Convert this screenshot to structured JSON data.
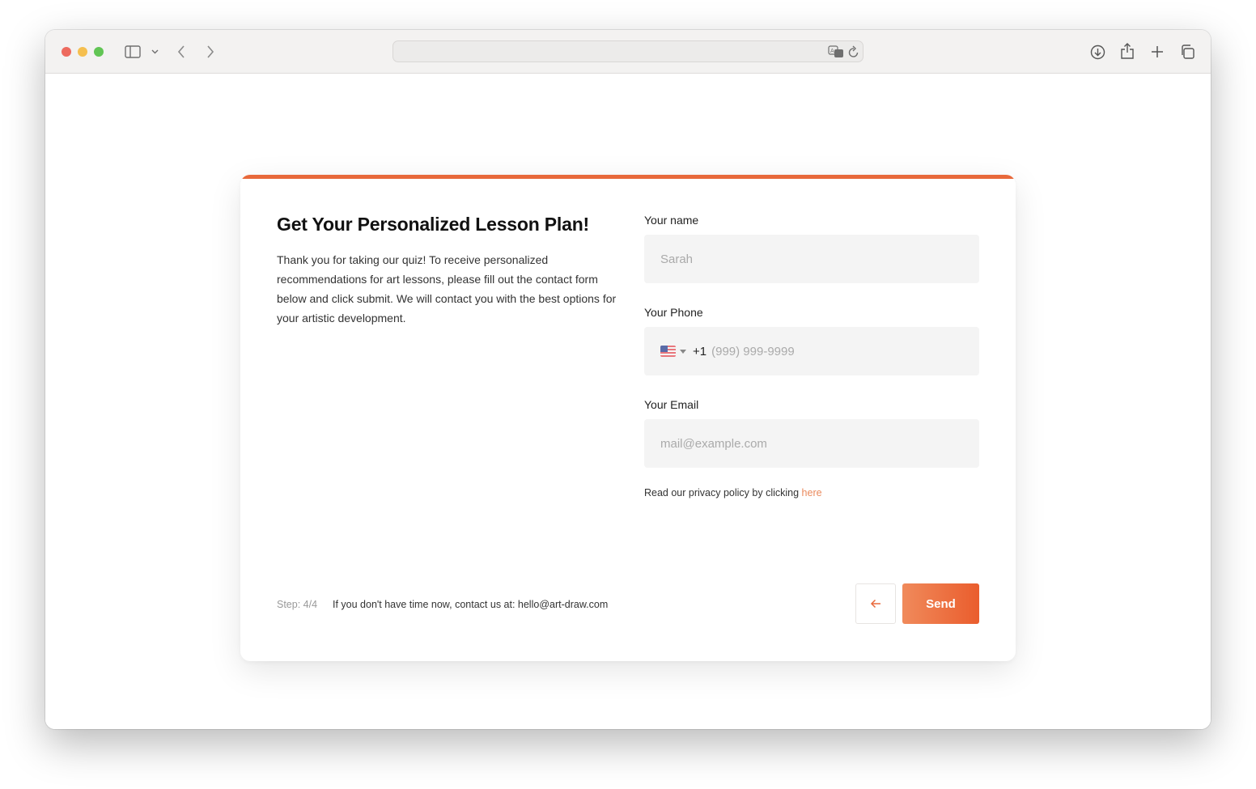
{
  "browser": {
    "url": "",
    "icons": {
      "sidebar": "sidebar-icon",
      "chevron": "chevron-down-icon",
      "back": "back-icon",
      "forward": "forward-icon",
      "translate": "translate-icon",
      "reload": "reload-icon",
      "download": "download-icon",
      "share": "share-icon",
      "new_tab": "plus-icon",
      "tabs": "tabs-overview-icon"
    }
  },
  "form": {
    "accent_color": "#e8693b",
    "heading": "Get Your Personalized Lesson Plan!",
    "description": "Thank you for taking our quiz! To receive personalized recommendations for art lessons, please fill out the contact form below and click submit. We will contact you with the best options for your artistic development.",
    "name_label": "Your name",
    "name_placeholder": "Sarah",
    "phone_label": "Your Phone",
    "phone_country": "us-flag-icon",
    "phone_code": "+1",
    "phone_placeholder": "(999) 999-9999",
    "email_label": "Your Email",
    "email_placeholder": "mail@example.com",
    "privacy_text": "Read our privacy policy by clicking",
    "privacy_link": "here",
    "step": "Step: 4/4",
    "contact_note": "If you don't have time now, contact us at: hello@art-draw.com",
    "send_label": "Send"
  }
}
